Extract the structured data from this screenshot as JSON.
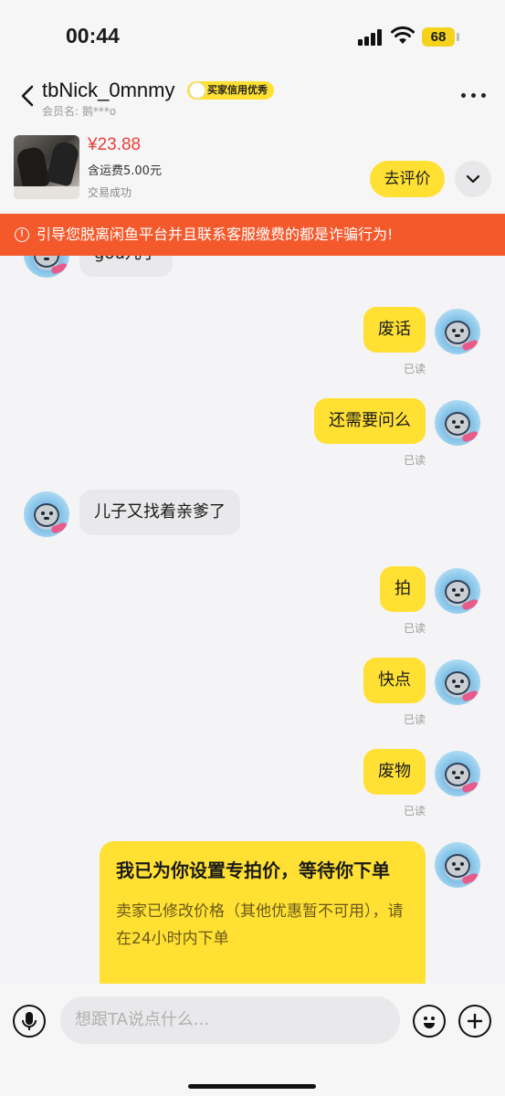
{
  "status_bar": {
    "time": "00:44",
    "battery": "68"
  },
  "header": {
    "nickname": "tbNick_0mnmy",
    "credit_badge": "买家信用优秀",
    "member_label": "会员名: 鹅***o"
  },
  "product": {
    "price": "¥23.88",
    "shipping": "含运费5.00元",
    "status": "交易成功",
    "review_button": "去评价"
  },
  "warning": "引导您脱离闲鱼平台并且联系客服缴费的都是诈骗行为!",
  "messages": [
    {
      "side": "them",
      "text": "gou儿子"
    },
    {
      "side": "me",
      "text": "废话",
      "status": "已读"
    },
    {
      "side": "me",
      "text": "还需要问么",
      "status": "已读"
    },
    {
      "side": "them",
      "text": "儿子又找着亲爹了"
    },
    {
      "side": "me",
      "text": "拍",
      "status": "已读"
    },
    {
      "side": "me",
      "text": "快点",
      "status": "已读"
    },
    {
      "side": "me",
      "text": "废物",
      "status": "已读"
    }
  ],
  "price_card": {
    "title": "我已为你设置专拍价，等待你下单",
    "body": "卖家已修改价格（其他优惠暂不可用），请在24小时内下单"
  },
  "input": {
    "placeholder": "想跟TA说点什么..."
  },
  "colors": {
    "accent": "#ffe033",
    "warning": "#f4592b",
    "price": "#e8403a"
  }
}
